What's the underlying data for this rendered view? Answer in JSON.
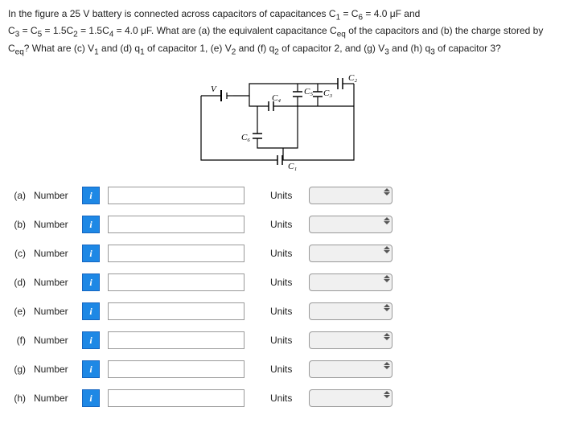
{
  "question": {
    "line1_a": "In the figure a 25 V battery is connected across capacitors of capacitances C",
    "line1_b": " = C",
    "line1_c": " = 4.0 μF and",
    "line2_a": "C",
    "line2_b": " = C",
    "line2_c": " = 1.5C",
    "line2_d": " = 1.5C",
    "line2_e": " = 4.0 μF.  What are (a) the equivalent capacitance C",
    "line2_f": " of the capacitors and (b) the charge stored by",
    "line3_a": "C",
    "line3_b": "? What are (c) V",
    "line3_c": " and (d) q",
    "line3_d": " of capacitor 1, (e) V",
    "line3_e": " and (f) q",
    "line3_f": " of capacitor 2, and (g) V",
    "line3_g": " and (h) q",
    "line3_h": " of capacitor 3?",
    "s1": "1",
    "s6": "6",
    "s3": "3",
    "s5": "5",
    "s2": "2",
    "s4": "4",
    "seq": "eq"
  },
  "circuit": {
    "V": "V",
    "C1": "C₁",
    "C2": "C₂",
    "C3": "C₃",
    "C4": "C₄",
    "C5": "C₅",
    "C6": "C₆"
  },
  "rows": {
    "number_label": "Number",
    "units_label": "Units",
    "info_symbol": "i",
    "a": "(a)",
    "b": "(b)",
    "c": "(c)",
    "d": "(d)",
    "e": "(e)",
    "f": "(f)",
    "g": "(g)",
    "h": "(h)"
  }
}
